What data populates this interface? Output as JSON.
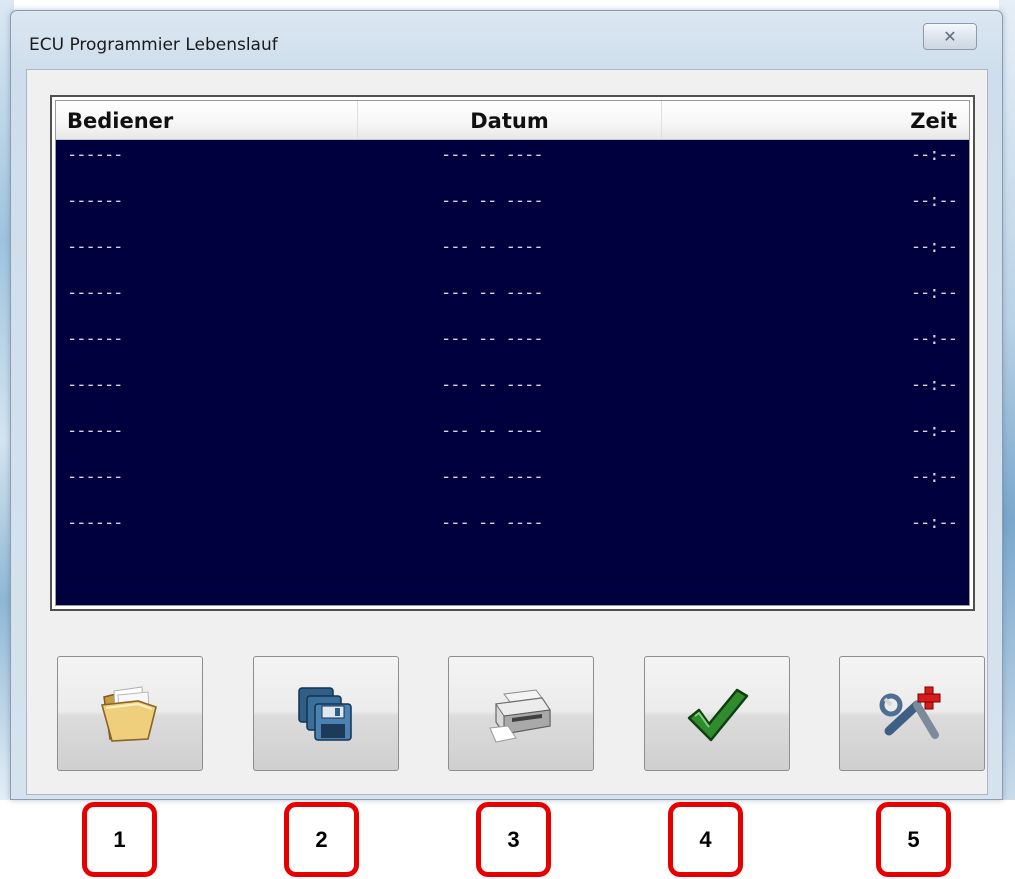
{
  "window": {
    "title": "ECU Programmier Lebenslauf",
    "close_glyph": "✕"
  },
  "list": {
    "columns": [
      "Bediener",
      "Datum",
      "Zeit"
    ],
    "rows": [
      [
        "------",
        "--- -- ----",
        "--:--"
      ],
      [
        "------",
        "--- -- ----",
        "--:--"
      ],
      [
        "------",
        "--- -- ----",
        "--:--"
      ],
      [
        "------",
        "--- -- ----",
        "--:--"
      ],
      [
        "------",
        "--- -- ----",
        "--:--"
      ],
      [
        "------",
        "--- -- ----",
        "--:--"
      ],
      [
        "------",
        "--- -- ----",
        "--:--"
      ],
      [
        "------",
        "--- -- ----",
        "--:--"
      ],
      [
        "------",
        "--- -- ----",
        "--:--"
      ]
    ],
    "background_color": "#00003f"
  },
  "toolbar": {
    "buttons": [
      {
        "icon": "folder-icon"
      },
      {
        "icon": "floppy-disks-icon"
      },
      {
        "icon": "printer-icon"
      },
      {
        "icon": "checkmark-icon"
      },
      {
        "icon": "tools-add-icon"
      }
    ]
  },
  "annotations": {
    "labels": [
      "1",
      "2",
      "3",
      "4",
      "5"
    ],
    "color": "#e60000"
  }
}
